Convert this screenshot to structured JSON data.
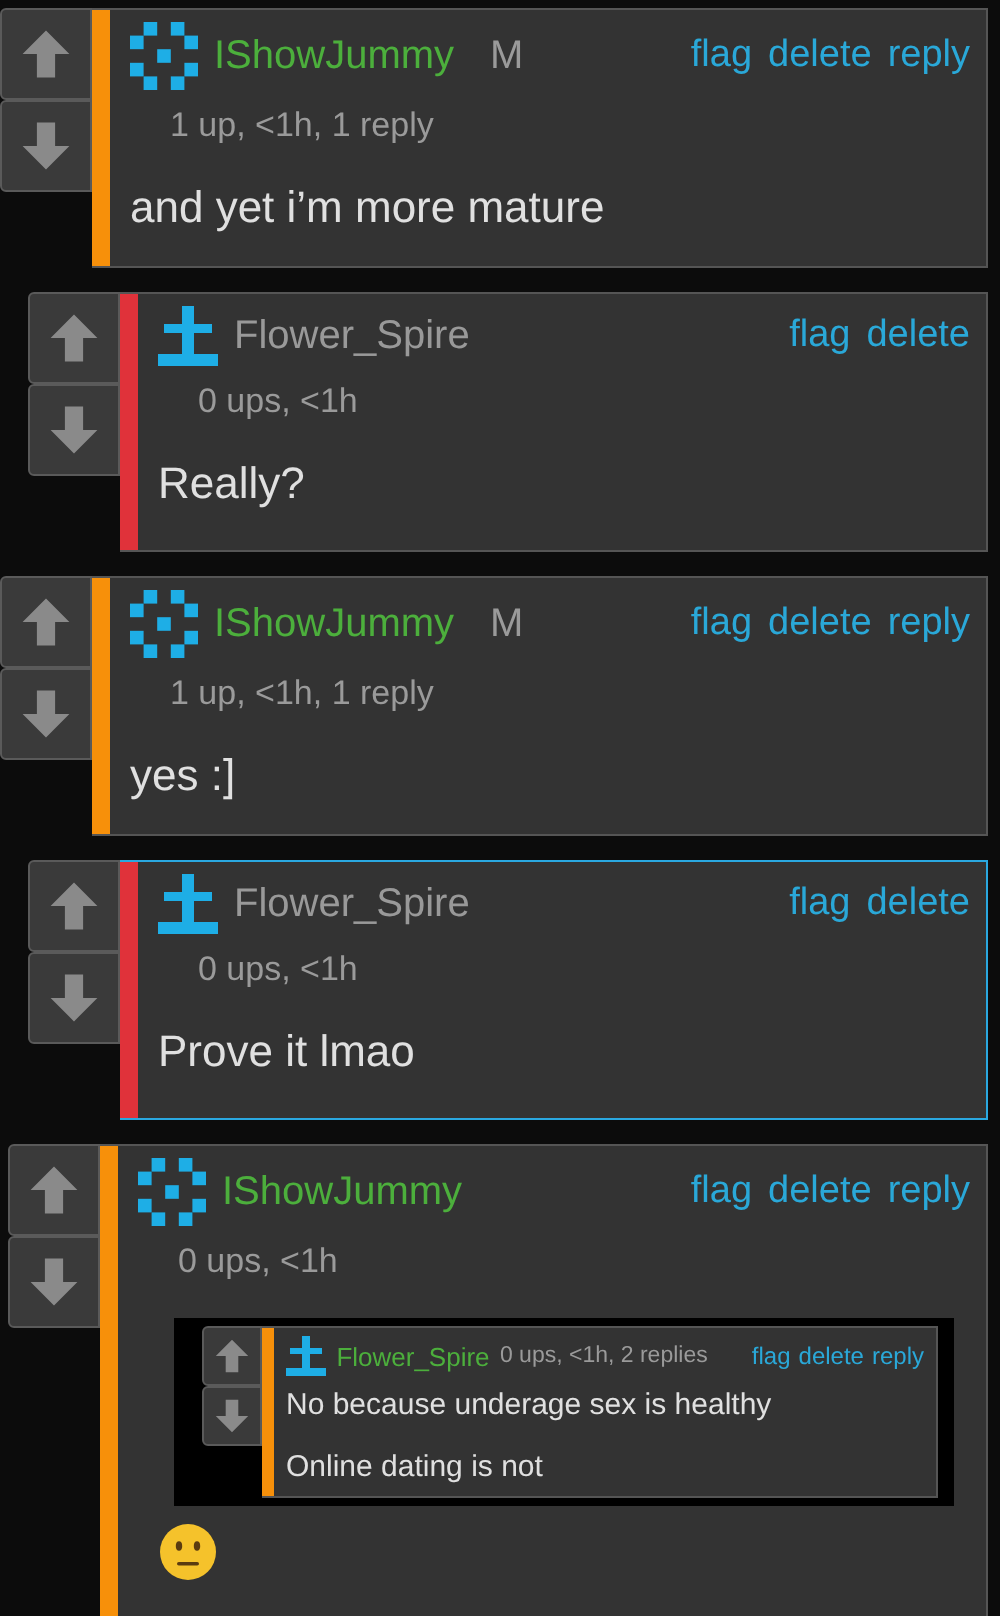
{
  "comments": [
    {
      "user": {
        "text": "IShowJummy",
        "color": "#4caf3c"
      },
      "avatar": {
        "kind": "dots"
      },
      "tag": "M",
      "meta": "1 up, <1h, 1 reply",
      "body": [
        "and yet i’m more mature"
      ],
      "actions": [
        "flag",
        "delete",
        "reply"
      ],
      "color": "#f7900a",
      "highlighted": false,
      "children": [
        {
          "user": {
            "text": "Flower_Spire",
            "color": "#999999"
          },
          "avatar": {
            "kind": "cross"
          },
          "meta": "0 ups, <1h",
          "body": [
            "Really?"
          ],
          "actions": [
            "flag",
            "delete"
          ],
          "color": "#e0323a",
          "highlighted": false
        }
      ]
    },
    {
      "user": {
        "text": "IShowJummy",
        "color": "#4caf3c"
      },
      "avatar": {
        "kind": "dots"
      },
      "tag": "M",
      "meta": "1 up, <1h, 1 reply",
      "body": [
        "yes :]"
      ],
      "actions": [
        "flag",
        "delete",
        "reply"
      ],
      "color": "#f7900a",
      "highlighted": false,
      "children": [
        {
          "user": {
            "text": "Flower_Spire",
            "color": "#999999"
          },
          "avatar": {
            "kind": "cross"
          },
          "meta": "0 ups, <1h",
          "body": [
            "Prove it lmao"
          ],
          "actions": [
            "flag",
            "delete"
          ],
          "color": "#e0323a",
          "highlighted": true
        }
      ]
    },
    {
      "user": {
        "text": "IShowJummy",
        "color": "#4caf3c"
      },
      "avatar": {
        "kind": "dots"
      },
      "meta": "0 ups, <1h",
      "actions": [
        "flag",
        "delete",
        "reply"
      ],
      "color": "#f7900a",
      "highlighted": false,
      "attachment": {
        "user": {
          "text": "Flower_Spire",
          "color": "#4caf3c"
        },
        "avatar": {
          "kind": "cross"
        },
        "meta": "0 ups, <1h, 2 replies",
        "actions": [
          "flag",
          "delete",
          "reply"
        ],
        "color": "#f7900a",
        "body": [
          "No because underage sex is healthy",
          "Online dating is not"
        ]
      },
      "emoji": {
        "kind": "neutral"
      }
    }
  ]
}
